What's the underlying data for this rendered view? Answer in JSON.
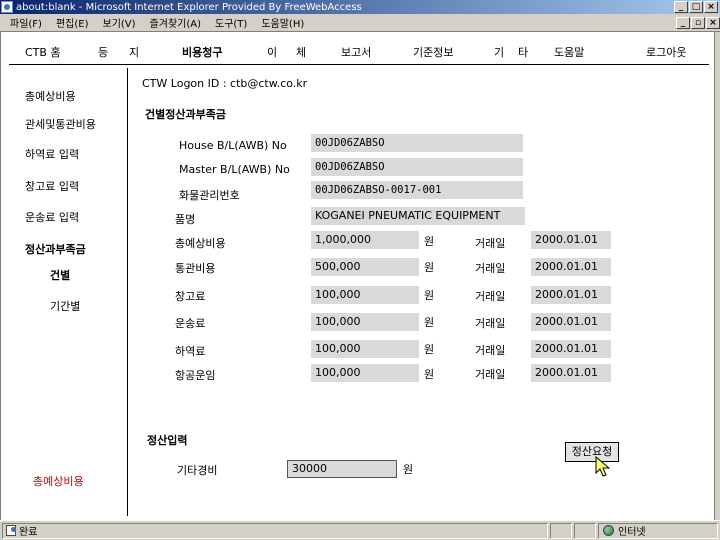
{
  "window": {
    "title": "about:blank - Microsoft Internet Explorer Provided By FreeWebAccess"
  },
  "menubar": [
    "파일(F)",
    "편집(E)",
    "보기(V)",
    "즐겨찾기(A)",
    "도구(T)",
    "도움말(H)"
  ],
  "topnav": {
    "items": [
      "CTB 홈",
      "등",
      "지",
      "비용청구",
      "이",
      "체",
      "보고서",
      "기준정보",
      "기",
      "타",
      "도움말",
      "로그아웃"
    ]
  },
  "sidebar": {
    "items": [
      "총예상비용",
      "관세및통관비용",
      "하역료 입력",
      "창고료 입력",
      "운송료 입력",
      "정산과부족금",
      "건별",
      "기간별"
    ],
    "footer": "총예상비용"
  },
  "logon": "CTW Logon ID : ctb@ctw.co.kr",
  "section_title": "건별정산과부족금",
  "fields": {
    "house_bl": {
      "label": "House B/L(AWB) No",
      "value": "00JD06ZABSO"
    },
    "master_bl": {
      "label": "Master B/L(AWB) No",
      "value": "00JD06ZABSO"
    },
    "cargo_no": {
      "label": "화물관리번호",
      "value": "00JD06ZABSO-0017-001"
    },
    "item_name": {
      "label": "품명",
      "value": "KOGANEI PNEUMATIC EQUIPMENT"
    }
  },
  "cost_rows": [
    {
      "label": "총예상비용",
      "amount": "1,000,000",
      "unit": "원",
      "date_label": "거래일",
      "date": "2000.01.01"
    },
    {
      "label": "통관비용",
      "amount": "500,000",
      "unit": "원",
      "date_label": "거래일",
      "date": "2000.01.01"
    },
    {
      "label": "창고료",
      "amount": "100,000",
      "unit": "원",
      "date_label": "거래일",
      "date": "2000.01.01"
    },
    {
      "label": "운송료",
      "amount": "100,000",
      "unit": "원",
      "date_label": "거래일",
      "date": "2000.01.01"
    },
    {
      "label": "하역료",
      "amount": "100,000",
      "unit": "원",
      "date_label": "거래일",
      "date": "2000.01.01"
    },
    {
      "label": "항공운임",
      "amount": "100,000",
      "unit": "원",
      "date_label": "거래일",
      "date": "2000.01.01"
    }
  ],
  "settlement": {
    "title": "정산입력",
    "other_label": "기타경비",
    "other_value": "30000",
    "other_unit": "원",
    "request_button": "정산요청"
  },
  "statusbar": {
    "left": "완료",
    "zone": "인터넷"
  }
}
